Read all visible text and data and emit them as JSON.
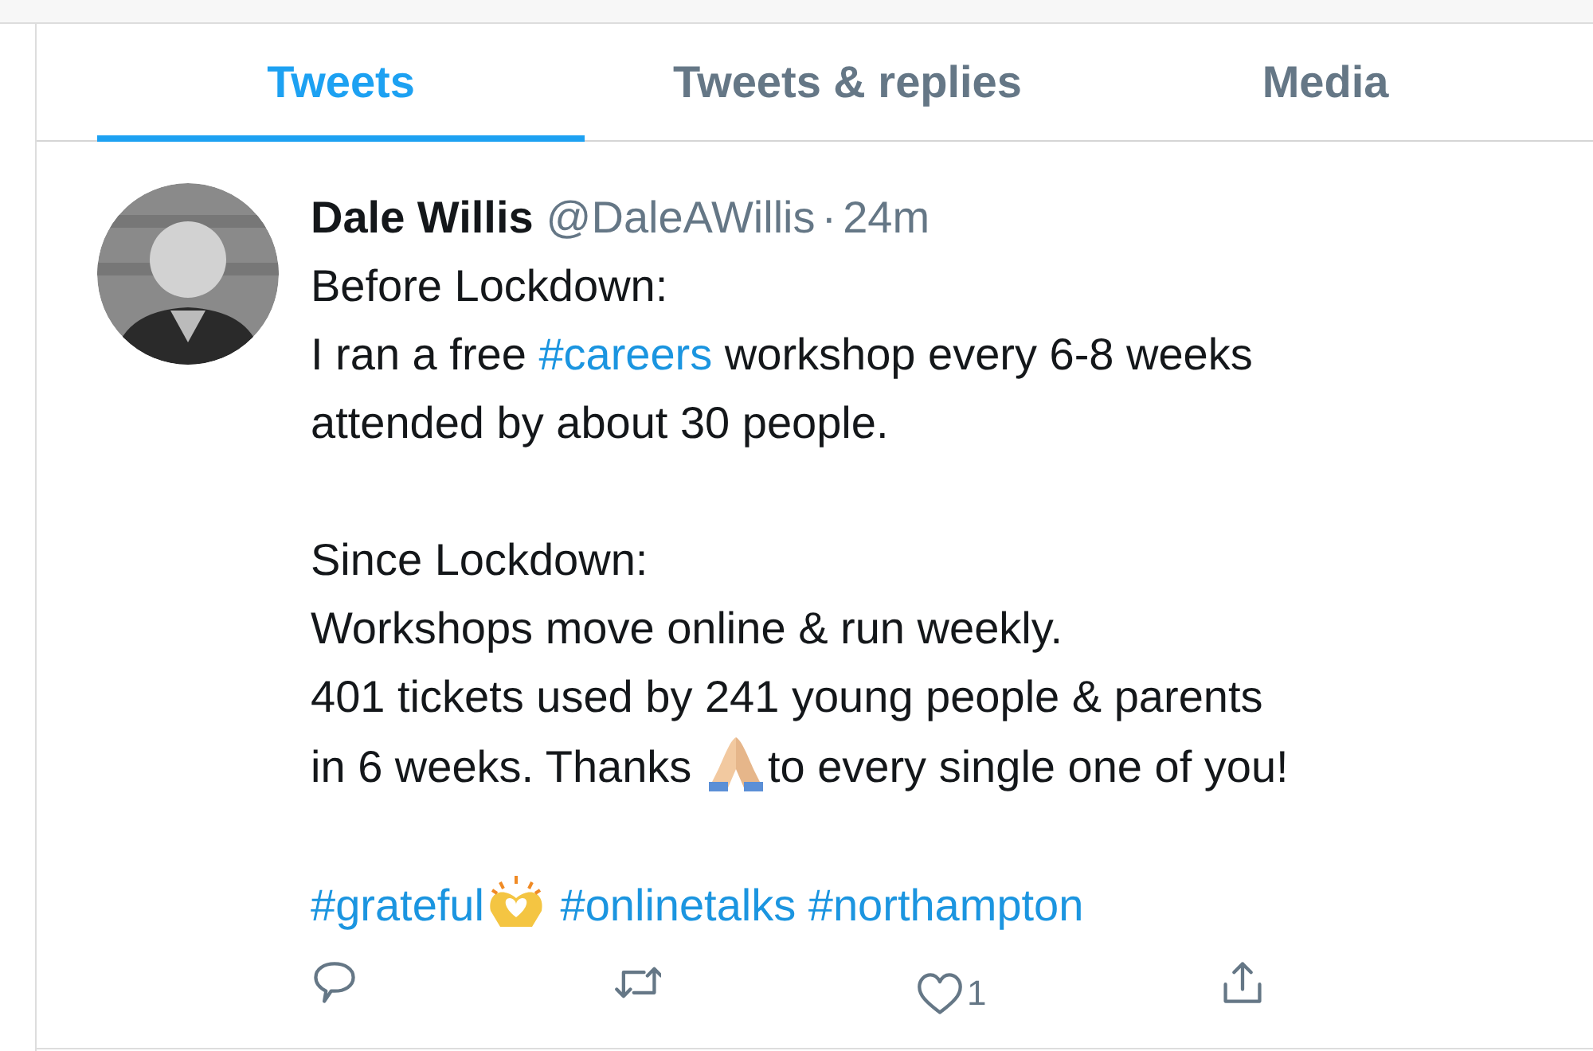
{
  "tabs": [
    {
      "label": "Tweets",
      "selected": true
    },
    {
      "label": "Tweets & replies",
      "selected": false
    },
    {
      "label": "Media",
      "selected": false
    }
  ],
  "tweet": {
    "name": "Dale Willis",
    "handle": "@DaleAWillis",
    "separator": "·",
    "time": "24m",
    "paragraphs": [
      [
        [
          {
            "kind": "text",
            "text": "Before Lockdown:"
          }
        ],
        [
          {
            "kind": "text",
            "text": "I ran a free "
          },
          {
            "kind": "hashtag",
            "text": "#careers"
          },
          {
            "kind": "text",
            "text": " workshop every 6-8 weeks"
          }
        ],
        [
          {
            "kind": "text",
            "text": "attended by about 30 people."
          }
        ]
      ],
      [
        [
          {
            "kind": "text",
            "text": "Since Lockdown:"
          }
        ],
        [
          {
            "kind": "text",
            "text": "Workshops move online & run weekly."
          }
        ],
        [
          {
            "kind": "text",
            "text": "401 tickets used by 241 young people & parents"
          }
        ],
        [
          {
            "kind": "text",
            "text": "in 6 weeks. Thanks "
          },
          {
            "kind": "emoji-folded-hands"
          },
          {
            "kind": "text",
            "text": "to every single one of you!"
          }
        ]
      ],
      [
        [
          {
            "kind": "hashtag",
            "text": "#grateful"
          },
          {
            "kind": "emoji-heart-hands"
          },
          {
            "kind": "space"
          },
          {
            "kind": "hashtag",
            "text": "#onlinetalks"
          },
          {
            "kind": "space"
          },
          {
            "kind": "hashtag",
            "text": "#northampton"
          }
        ]
      ]
    ],
    "actions": [
      {
        "kind": "reply"
      },
      {
        "kind": "retweet"
      },
      {
        "kind": "like",
        "count": "1"
      },
      {
        "kind": "share"
      }
    ]
  }
}
